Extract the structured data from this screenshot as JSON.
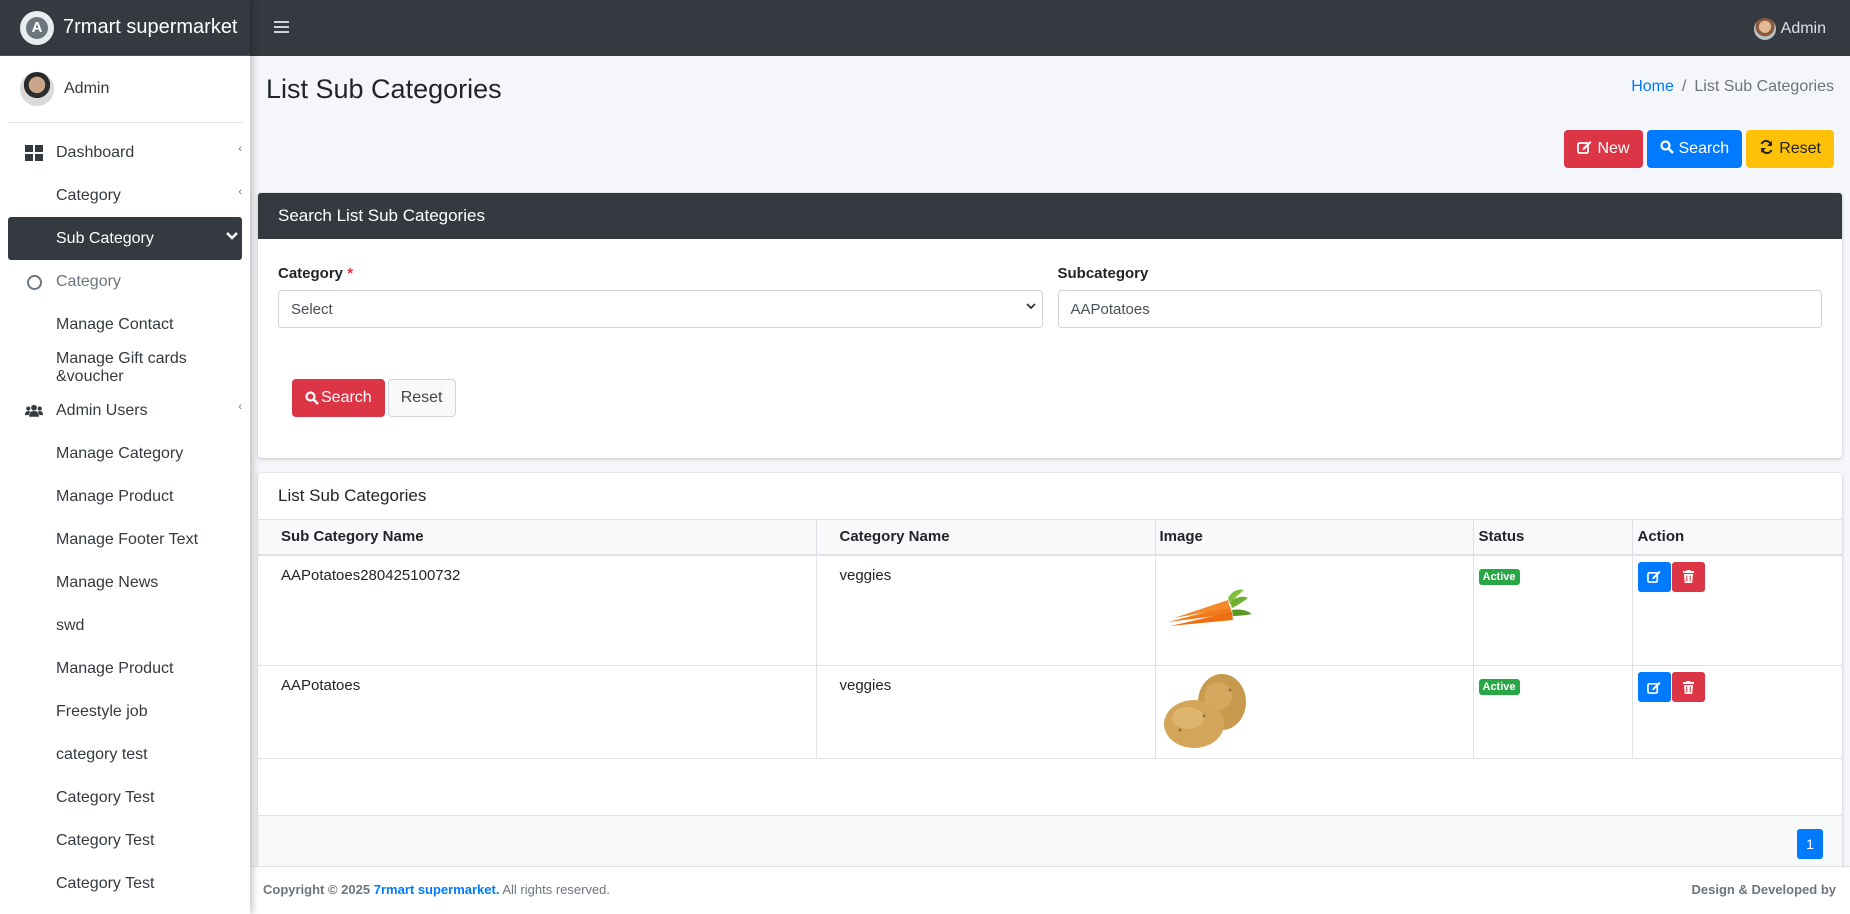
{
  "app": {
    "brand": "7rmart supermarket",
    "user": "Admin"
  },
  "sidebar": {
    "user": "Admin",
    "items": [
      {
        "label": "Dashboard",
        "icon": "dashboard-icon",
        "caret": "‹"
      },
      {
        "label": "Category",
        "icon": "",
        "caret": "‹"
      },
      {
        "label": "Sub Category",
        "icon": "",
        "caret": "⌄",
        "active": true
      },
      {
        "label": "Category",
        "icon": "circle-icon"
      },
      {
        "label": "Manage Contact"
      },
      {
        "label": "Manage Gift cards &voucher"
      },
      {
        "label": "Admin Users",
        "icon": "users-icon",
        "caret": "‹"
      },
      {
        "label": "Manage Category"
      },
      {
        "label": "Manage Product"
      },
      {
        "label": "Manage Footer Text"
      },
      {
        "label": "Manage News"
      },
      {
        "label": "swd"
      },
      {
        "label": "Manage Product"
      },
      {
        "label": "Freestyle job"
      },
      {
        "label": "category test"
      },
      {
        "label": "Category Test"
      },
      {
        "label": "Category Test"
      },
      {
        "label": "Category Test"
      }
    ]
  },
  "page": {
    "title": "List Sub Categories",
    "breadcrumb": {
      "home": "Home",
      "sep": "/",
      "current": "List Sub Categories"
    },
    "actions": {
      "new": "New",
      "search": "Search",
      "reset": "Reset"
    }
  },
  "search_card": {
    "header": "Search List Sub Categories",
    "category_label": "Category",
    "required_mark": "*",
    "category_value": "Select",
    "subcategory_label": "Subcategory",
    "subcategory_value": "AAPotatoes",
    "search_button": "Search",
    "reset_button": "Reset"
  },
  "list_card": {
    "title": "List Sub Categories",
    "columns": [
      "Sub Category Name",
      "Category Name",
      "Image",
      "Status",
      "Action"
    ],
    "rows": [
      {
        "name": "AAPotatoes280425100732",
        "category": "veggies",
        "image": "carrot",
        "status": "Active"
      },
      {
        "name": "AAPotatoes",
        "category": "veggies",
        "image": "potato",
        "status": "Active"
      }
    ],
    "page": "1"
  },
  "footer": {
    "copyright": "Copyright © 2025",
    "brand": "7rmart supermarket.",
    "rights": "All rights reserved.",
    "credit": "Design & Developed by"
  },
  "colors": {
    "dark": "#343a40",
    "primary": "#007bff",
    "danger": "#dc3545",
    "warning": "#ffc107",
    "success": "#28a745"
  }
}
